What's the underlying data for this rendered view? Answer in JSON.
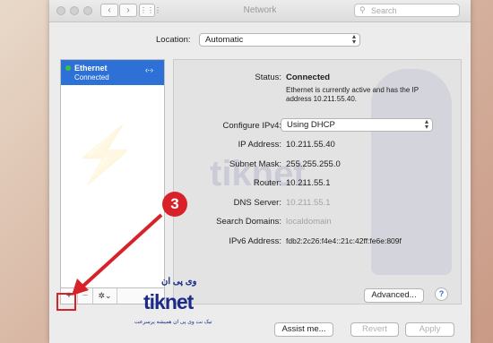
{
  "window": {
    "title": "Network"
  },
  "search": {
    "placeholder": "Search"
  },
  "location": {
    "label": "Location:",
    "value": "Automatic"
  },
  "sidebar": {
    "items": [
      {
        "name": "Ethernet",
        "status": "Connected",
        "icon": "ethernet-arrows-icon"
      }
    ],
    "add_label": "+",
    "remove_label": "−",
    "gear_label": "✲⌄"
  },
  "status": {
    "label": "Status:",
    "value": "Connected",
    "description": "Ethernet is currently active and has the IP address 10.211.55.40."
  },
  "fields": {
    "configure_ipv4": {
      "label": "Configure IPv4:",
      "value": "Using DHCP"
    },
    "ip_address": {
      "label": "IP Address:",
      "value": "10.211.55.40"
    },
    "subnet_mask": {
      "label": "Subnet Mask:",
      "value": "255.255.255.0"
    },
    "router": {
      "label": "Router:",
      "value": "10.211.55.1"
    },
    "dns_server": {
      "label": "DNS Server:",
      "value": "10.211.55.1"
    },
    "search_domains": {
      "label": "Search Domains:",
      "value": "localdomain"
    },
    "ipv6_address": {
      "label": "IPv6 Address:",
      "value": "fdb2:2c26:f4e4::21c:42ff:fe6e:809f"
    }
  },
  "buttons": {
    "advanced": "Advanced...",
    "help": "?",
    "assist": "Assist me...",
    "revert": "Revert",
    "apply": "Apply"
  },
  "annotation": {
    "step_number": "3",
    "color": "#d8222a"
  },
  "watermark": {
    "brand": "tiknet",
    "persian": "وی پی ان",
    "tagline": "تیک نت وی پی ان همیشه پرسرعت"
  },
  "colors": {
    "selection": "#2d70d6",
    "status_dot": "#35c63b"
  }
}
